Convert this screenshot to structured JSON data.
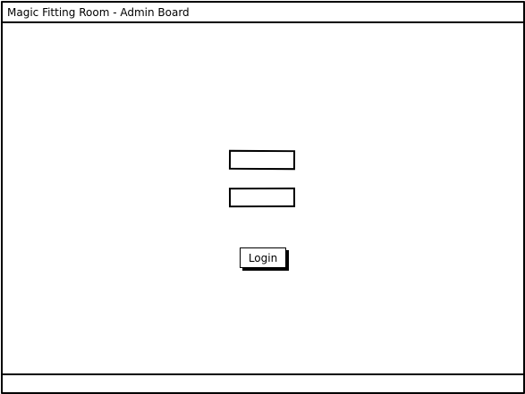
{
  "window": {
    "title": "Magic Fitting Room - Admin Board"
  },
  "login_form": {
    "username_value": "",
    "password_value": "",
    "login_label": "Login"
  },
  "status_bar": {
    "text": ""
  }
}
